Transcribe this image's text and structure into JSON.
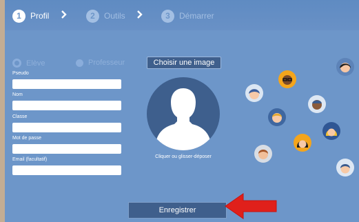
{
  "steps": [
    {
      "number": "1",
      "label": "Profil"
    },
    {
      "number": "2",
      "label": "Outils"
    },
    {
      "number": "3",
      "label": "Démarrer"
    }
  ],
  "role": {
    "options": [
      "Elève",
      "Professeur"
    ],
    "selected": "Elève"
  },
  "form": {
    "pseudo_label": "Pseudo",
    "nom_label": "Nom",
    "classe_label": "Classe",
    "password_label": "Mot de passe",
    "email_label": "Email (facultatif)",
    "pseudo_value": "",
    "nom_value": "",
    "classe_value": "",
    "password_value": "",
    "email_value": ""
  },
  "avatar": {
    "choose_label": "Choisir une image",
    "drop_hint": "Cliquer ou glisser-déposer"
  },
  "save_label": "Enregistrer",
  "colors": {
    "panel": "#6d96c9",
    "button": "#3f5f8c",
    "arrow": "#e0201b",
    "avatar_bg": "#3e5f8d"
  },
  "avatar_choices": [
    "dark-hair-girl-icon",
    "glasses-boy-icon",
    "blue-haired-kid-icon",
    "dark-skin-boy-icon",
    "blond-boy-icon",
    "blonde-girl-icon",
    "dark-haired-girl-icon",
    "brown-haired-boy-icon",
    "brunette-girl-icon"
  ]
}
